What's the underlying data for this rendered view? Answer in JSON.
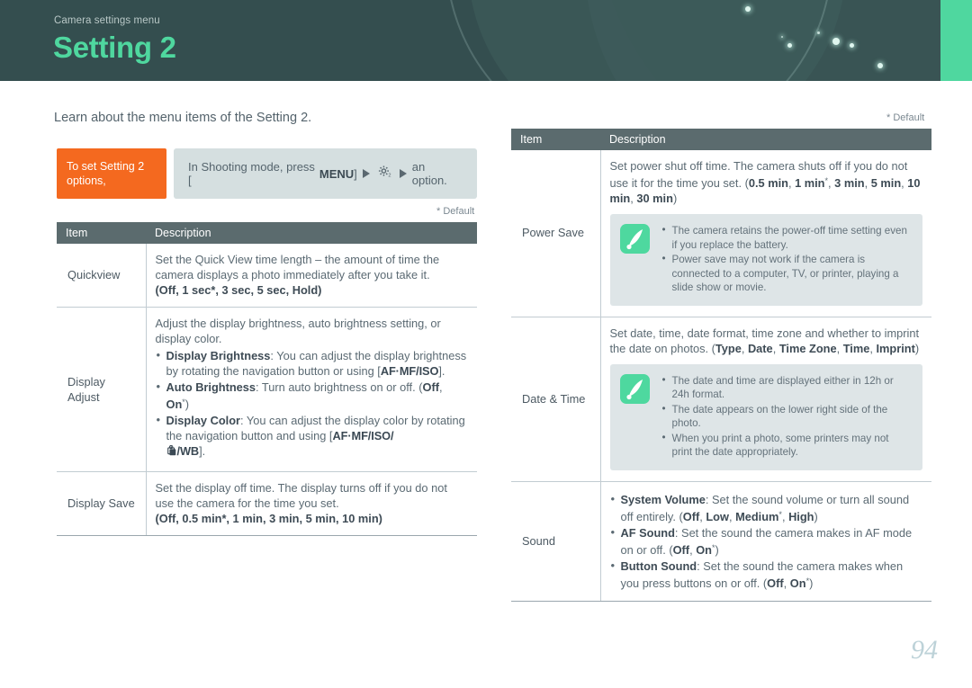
{
  "header": {
    "kicker": "Camera settings menu",
    "title": "Setting 2",
    "accent_color": "#4fd79f",
    "background_color": "#344e4f"
  },
  "intro": "Learn about the menu items of the Setting 2.",
  "callout": {
    "tag": "To set Setting 2 options,",
    "instruction_prefix": "In Shooting mode, press [",
    "menu_key": "MENU",
    "instruction_mid": "]",
    "gear_icon": "gear-2-icon",
    "instruction_suffix": "an option.",
    "tag_color": "#f4691f"
  },
  "default_note": "* Default",
  "left_table": {
    "columns": [
      "Item",
      "Description"
    ],
    "rows": [
      {
        "item": "Quickview",
        "lines": [
          "Set the Quick View time length – the amount of time the camera displays a photo immediately after you take it.",
          "(Off, 1 sec*, 3 sec, 5 sec, Hold)"
        ],
        "options": "(Off, 1 sec*, 3 sec, 5 sec, Hold)"
      },
      {
        "item": "Display Adjust",
        "intro": "Adjust the display brightness, auto brightness setting, or display color.",
        "bullets": [
          {
            "label": "Display Brightness",
            "text": "You can adjust the display brightness by rotating the navigation button or using [AF·MF/ISO]."
          },
          {
            "label": "Auto Brightness",
            "text": "Turn auto brightness on or off. (Off, On*)"
          },
          {
            "label": "Display Color",
            "text": "You can adjust the display color by rotating the navigation button and using [AF·MF/ISO/ 🔆/WB]."
          }
        ]
      },
      {
        "item": "Display Save",
        "lines": [
          "Set the display off time. The display turns off if you do not use the camera for the time you set.",
          "(Off, 0.5 min*, 1 min, 3 min, 5 min, 10 min)"
        ],
        "options": "(Off, 0.5 min*, 1 min, 3 min, 5 min, 10 min)"
      }
    ]
  },
  "right_table": {
    "columns": [
      "Item",
      "Description"
    ],
    "rows": [
      {
        "item": "Power Save",
        "text": "Set power shut off time. The camera shuts off if you do not use it for the time you set. (0.5 min, 1 min*, 3 min, 5 min, 10 min, 30 min)",
        "options": "(0.5 min, 1 min*, 3 min, 5 min, 10 min, 30 min)",
        "note": [
          "The camera retains the power-off time setting even if you replace the battery.",
          "Power save may not work if the camera is connected to a computer, TV, or printer, playing a slide show or movie."
        ]
      },
      {
        "item": "Date & Time",
        "text": "Set date, time, date format, time zone and whether to imprint the date on photos. (Type, Date, Time Zone, Time, Imprint)",
        "options": "(Type, Date, Time Zone, Time, Imprint)",
        "note": [
          "The date and time are displayed either in 12h or 24h format.",
          "The date appears on the lower right side of the photo.",
          "When you print a photo, some printers may not print the date appropriately."
        ]
      },
      {
        "item": "Sound",
        "bullets": [
          {
            "label": "System Volume",
            "text": "Set the sound volume or turn all sound off entirely. (Off, Low, Medium*, High)"
          },
          {
            "label": "AF Sound",
            "text": "Set the sound the camera makes in AF mode on or off. (Off, On*)"
          },
          {
            "label": "Button Sound",
            "text": "Set the sound the camera makes when you press buttons on or off. (Off, On*)"
          }
        ]
      }
    ]
  },
  "page_number": "94"
}
